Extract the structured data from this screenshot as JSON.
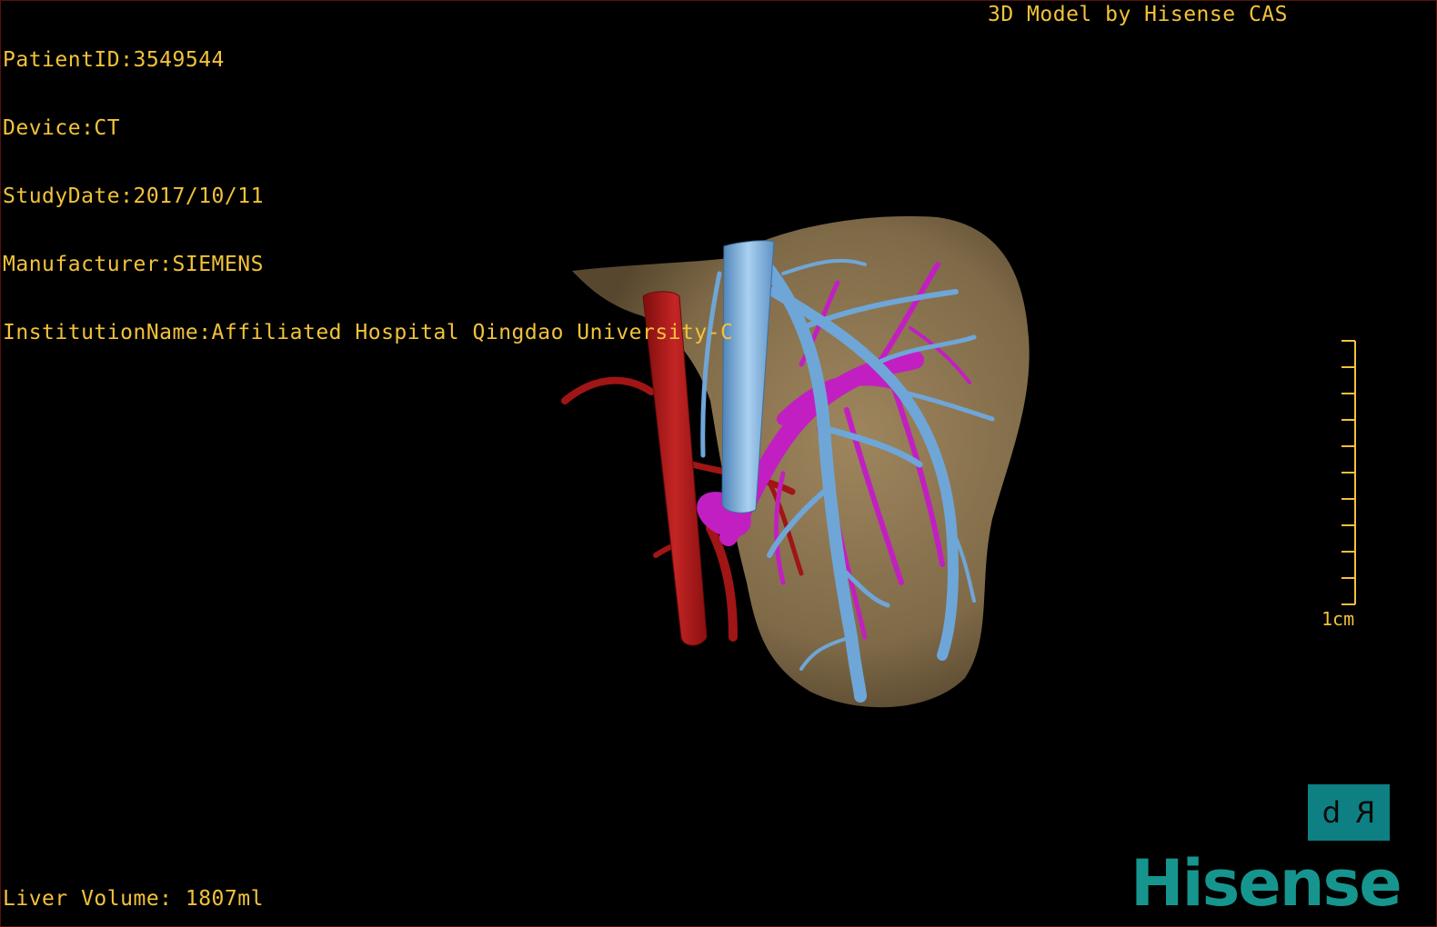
{
  "overlay": {
    "patient_id": "PatientID:3549544",
    "device": "Device:CT",
    "study_date": "StudyDate:2017/10/11",
    "manufacturer": "Manufacturer:SIEMENS",
    "institution": "InstitutionName:Affiliated Hospital Qingdao University-C",
    "model_credit": "3D Model by Hisense CAS",
    "liver_volume": "Liver Volume: 1807ml"
  },
  "scale": {
    "label": "1cm"
  },
  "orientation_cube": {
    "left_glyph": "d",
    "right_glyph": "R"
  },
  "brand": {
    "name": "Hisense"
  },
  "colors": {
    "overlay_text": "#f2c23a",
    "liver": "#8a7350",
    "artery": "#b01a1a",
    "hepatic_vein": "#6fa6d8",
    "portal_vein": "#c21fc2",
    "cube": "#0e7f82",
    "brand": "#16958f"
  },
  "structures": [
    "liver",
    "inferior-vena-cava",
    "hepatic-veins",
    "portal-vein",
    "hepatic-artery",
    "aorta"
  ]
}
